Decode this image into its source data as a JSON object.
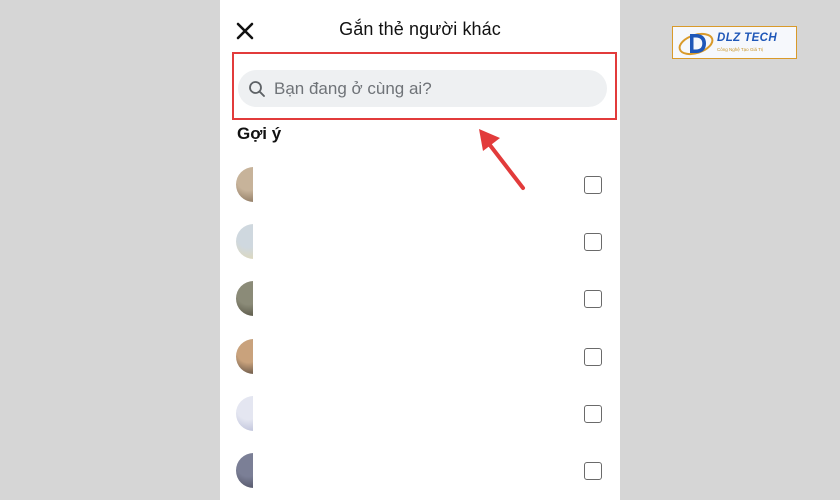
{
  "header": {
    "title": "Gắn thẻ người khác"
  },
  "search": {
    "placeholder": "Bạn đang ở cùng ai?"
  },
  "section": {
    "title": "Gợi ý"
  },
  "suggestions": [
    {
      "avatar_colors": [
        "#c7b39a",
        "#6f5a44"
      ]
    },
    {
      "avatar_colors": [
        "#cfd8df",
        "#e6d7a6"
      ]
    },
    {
      "avatar_colors": [
        "#8b8b78",
        "#3e3b2d"
      ]
    },
    {
      "avatar_colors": [
        "#c9a27c",
        "#2e2a29"
      ]
    },
    {
      "avatar_colors": [
        "#e4e6f1",
        "#a9aecd"
      ]
    },
    {
      "avatar_colors": [
        "#7b7f96",
        "#3d3e4e"
      ]
    }
  ],
  "logo": {
    "name": "DLZ TECH",
    "tagline": "Công Nghệ Tạo Giá Trị"
  },
  "colors": {
    "highlight": "#e23b3b",
    "arrow": "#e23b3b",
    "background": "#d6d6d6"
  }
}
